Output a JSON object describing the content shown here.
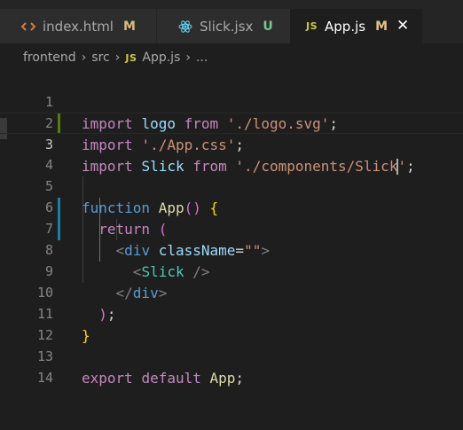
{
  "tabs": [
    {
      "icon": "html-icon",
      "label": "index.html",
      "status": "M"
    },
    {
      "icon": "react-icon",
      "label": "Slick.jsx",
      "status": "U"
    },
    {
      "icon": "js-icon",
      "label": "App.js",
      "status": "M",
      "badge": "JS"
    }
  ],
  "close_glyph": "✕",
  "breadcrumb": {
    "items": [
      "frontend",
      "src",
      "App.js",
      "..."
    ],
    "badge": "JS",
    "separator": "›"
  },
  "editor": {
    "line_numbers": [
      "1",
      "2",
      "3",
      "4",
      "5",
      "6",
      "7",
      "8",
      "9",
      "10",
      "11",
      "12",
      "13",
      "14"
    ],
    "current_line": "3",
    "lines": {
      "l1": {
        "kw": "import",
        "id": "logo",
        "from": "from",
        "str": "'./logo.svg'",
        "end": ";"
      },
      "l2": {
        "kw": "import",
        "str": "'./App.css'",
        "end": ";"
      },
      "l3": {
        "kw": "import",
        "id": "Slick",
        "from": "from",
        "str_a": "'./components/Slick",
        "str_b": "'",
        "end": ";"
      },
      "l5": {
        "kw": "function",
        "name": "App",
        "parens": "()",
        "brace": "{"
      },
      "l6": {
        "kw": "return",
        "paren": "("
      },
      "l7": {
        "open": "<",
        "tag": "div",
        "attr": "className",
        "eq": "=",
        "val": "\"\"",
        "close": ">"
      },
      "l8": {
        "open": "<",
        "tag": "Slick",
        "close": "/>"
      },
      "l9": {
        "open": "</",
        "tag": "div",
        "close": ">"
      },
      "l10": {
        "paren": ")",
        "end": ";"
      },
      "l11": {
        "brace": "}"
      },
      "l13": {
        "kw1": "export",
        "kw2": "default",
        "id": "App",
        "end": ";"
      }
    }
  }
}
